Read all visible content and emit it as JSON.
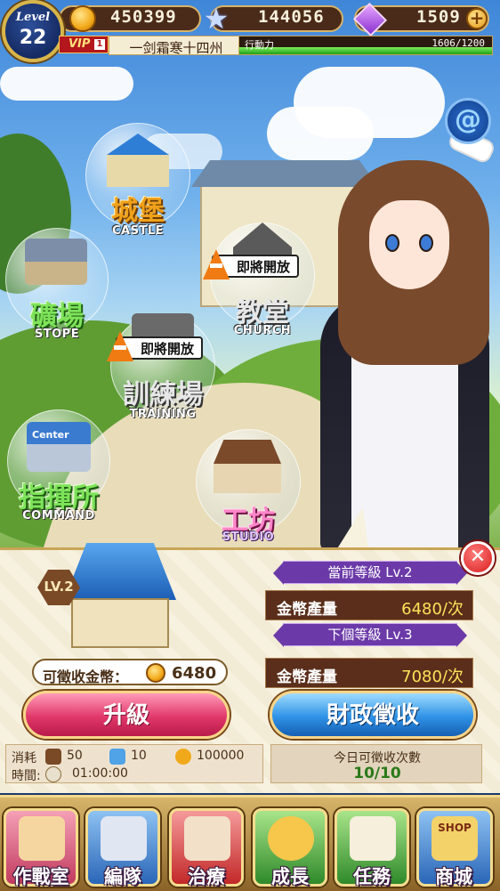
{
  "hud": {
    "level_label": "Level",
    "level": "22",
    "gold": "450399",
    "stars": "144056",
    "gems": "1509",
    "vip_label": "VIP",
    "vip_level": "1",
    "player_name": "一剑霜寒十四州",
    "stamina_label": "行動力",
    "stamina_value": "1606/1200",
    "stamina_fill": 1.0
  },
  "buildings": [
    {
      "cn": "城堡",
      "en": "CASTLE"
    },
    {
      "cn": "礦場",
      "en": "STOPE"
    },
    {
      "cn": "教堂",
      "en": "CHURCH",
      "badge": "即將開放"
    },
    {
      "cn": "訓練場",
      "en": "TRAINING",
      "badge": "即將開放"
    },
    {
      "cn": "指揮所",
      "en": "COMMAND",
      "sign": "Center"
    },
    {
      "cn": "工坊",
      "en": "STUDIO"
    }
  ],
  "panel": {
    "level_badge": "LV.2",
    "collectable_label": "可徵收金幣：",
    "collectable_value": "6480",
    "current_level": "當前等級 Lv.2",
    "current_prod_label": "金幣產量",
    "current_prod_value": "6480/次",
    "next_level": "下個等級 Lv.3",
    "next_prod_label": "金幣產量",
    "next_prod_value": "7080/次",
    "upgrade_label": "升級",
    "collect_label": "財政徵收",
    "cost_label": "消耗",
    "cost_wood": "50",
    "cost_crystal": "10",
    "cost_gold": "100000",
    "time_label": "時間:",
    "time_value": "01:00:00",
    "today_label": "今日可徵收次數",
    "today_value": "10/10"
  },
  "nav": [
    {
      "label": "作戰室",
      "color": "#d9485f"
    },
    {
      "label": "編隊",
      "color": "#3a77c9"
    },
    {
      "label": "治療",
      "color": "#d23b3b"
    },
    {
      "label": "成長",
      "color": "#3fa33a"
    },
    {
      "label": "任務",
      "color": "#47a83c"
    },
    {
      "label": "商城",
      "color": "#2f7fd0",
      "sign": "SHOP"
    }
  ]
}
